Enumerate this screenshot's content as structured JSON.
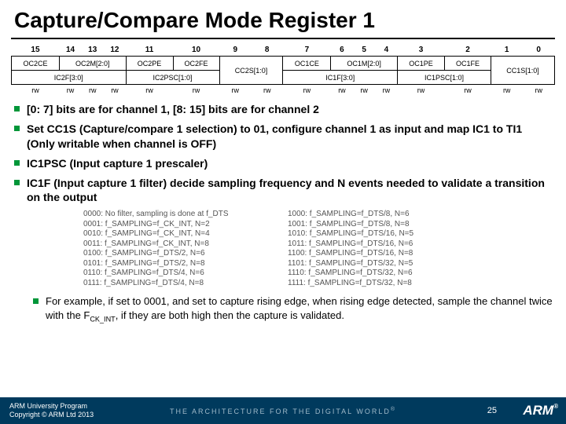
{
  "title": "Capture/Compare Mode Register 1",
  "register": {
    "bits": [
      "15",
      "14",
      "13",
      "12",
      "11",
      "10",
      "9",
      "8",
      "7",
      "6",
      "5",
      "4",
      "3",
      "2",
      "1",
      "0"
    ],
    "row_out": [
      "OC2CE",
      "OC2M[2:0]",
      "OC2PE",
      "OC2FE",
      "CC2S[1:0]",
      "OC1CE",
      "OC1M[2:0]",
      "OC1PE",
      "OC1FE",
      "CC1S[1:0]"
    ],
    "row_in": [
      "IC2F[3:0]",
      "IC2PSC[1:0]",
      "",
      "IC1F[3:0]",
      "IC1PSC[1:0]",
      ""
    ],
    "rw": "rw"
  },
  "bullets": [
    "[0: 7] bits are for channel 1, [8: 15] bits are for channel 2",
    "Set CC1S (Capture/compare 1 selection) to 01, configure channel 1 as input and map IC1 to TI1 (Only writable when channel is OFF)",
    "IC1PSC (Input capture 1 prescaler)",
    "IC1F (Input capture 1 filter) decide sampling frequency and N events needed to validate a transition on the output"
  ],
  "filter_left": [
    "0000: No filter, sampling is done at f_DTS",
    "0001: f_SAMPLING=f_CK_INT, N=2",
    "0010: f_SAMPLING=f_CK_INT, N=4",
    "0011: f_SAMPLING=f_CK_INT, N=8",
    "0100: f_SAMPLING=f_DTS/2, N=6",
    "0101: f_SAMPLING=f_DTS/2, N=8",
    "0110: f_SAMPLING=f_DTS/4, N=6",
    "0111: f_SAMPLING=f_DTS/4, N=8"
  ],
  "filter_right": [
    "1000: f_SAMPLING=f_DTS/8, N=6",
    "1001: f_SAMPLING=f_DTS/8, N=8",
    "1010: f_SAMPLING=f_DTS/16, N=5",
    "1011: f_SAMPLING=f_DTS/16, N=6",
    "1100: f_SAMPLING=f_DTS/16, N=8",
    "1101: f_SAMPLING=f_DTS/32, N=5",
    "1110: f_SAMPLING=f_DTS/32, N=6",
    "1111: f_SAMPLING=f_DTS/32, N=8"
  ],
  "example_pre": "For example, if set to  0001, and set to capture rising edge, when rising edge detected, sample the channel twice with the F",
  "example_sub": "CK_INT",
  "example_post": ", if they are both high then the capture is validated.",
  "footer": {
    "line1": "ARM University Program",
    "line2": "Copyright © ARM Ltd 2013",
    "tagline": "THE ARCHITECTURE FOR THE DIGITAL WORLD",
    "page": "25",
    "logo": "ARM"
  }
}
